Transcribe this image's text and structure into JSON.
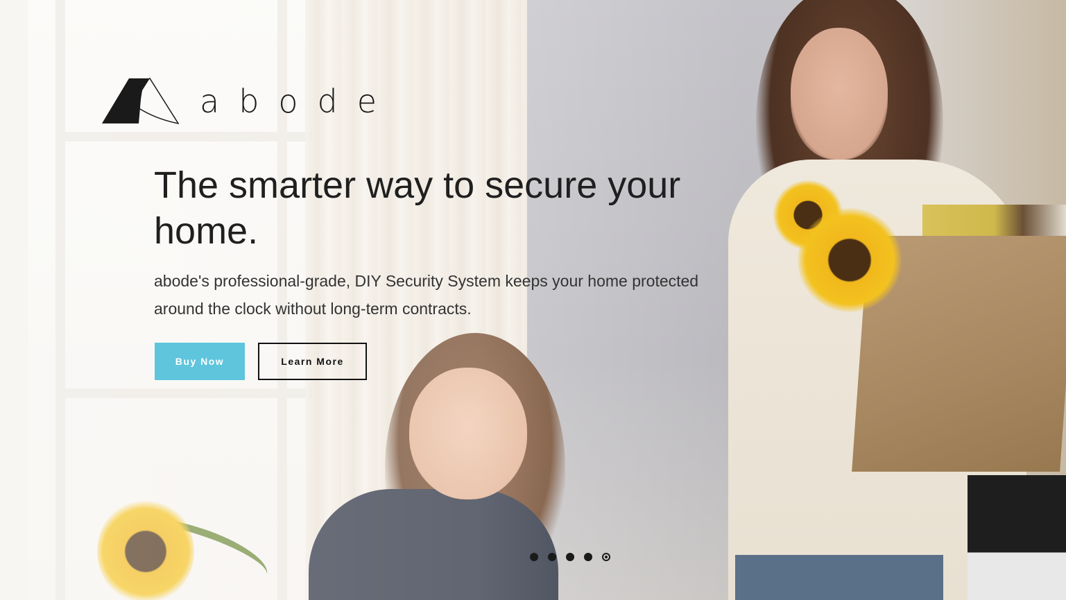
{
  "brand": {
    "name": "abode",
    "logo_icon": "abode-logo-mark"
  },
  "hero": {
    "headline": "The smarter way to secure your home.",
    "subtext": "abode's professional-grade, DIY Security System keeps your home protected around the clock without long-term contracts.",
    "buy_now_label": "Buy Now",
    "learn_more_label": "Learn More"
  },
  "carousel": {
    "slide_count": 5,
    "active_index": 5
  },
  "colors": {
    "accent": "#5ec5dd",
    "text": "#1f1f1f"
  }
}
